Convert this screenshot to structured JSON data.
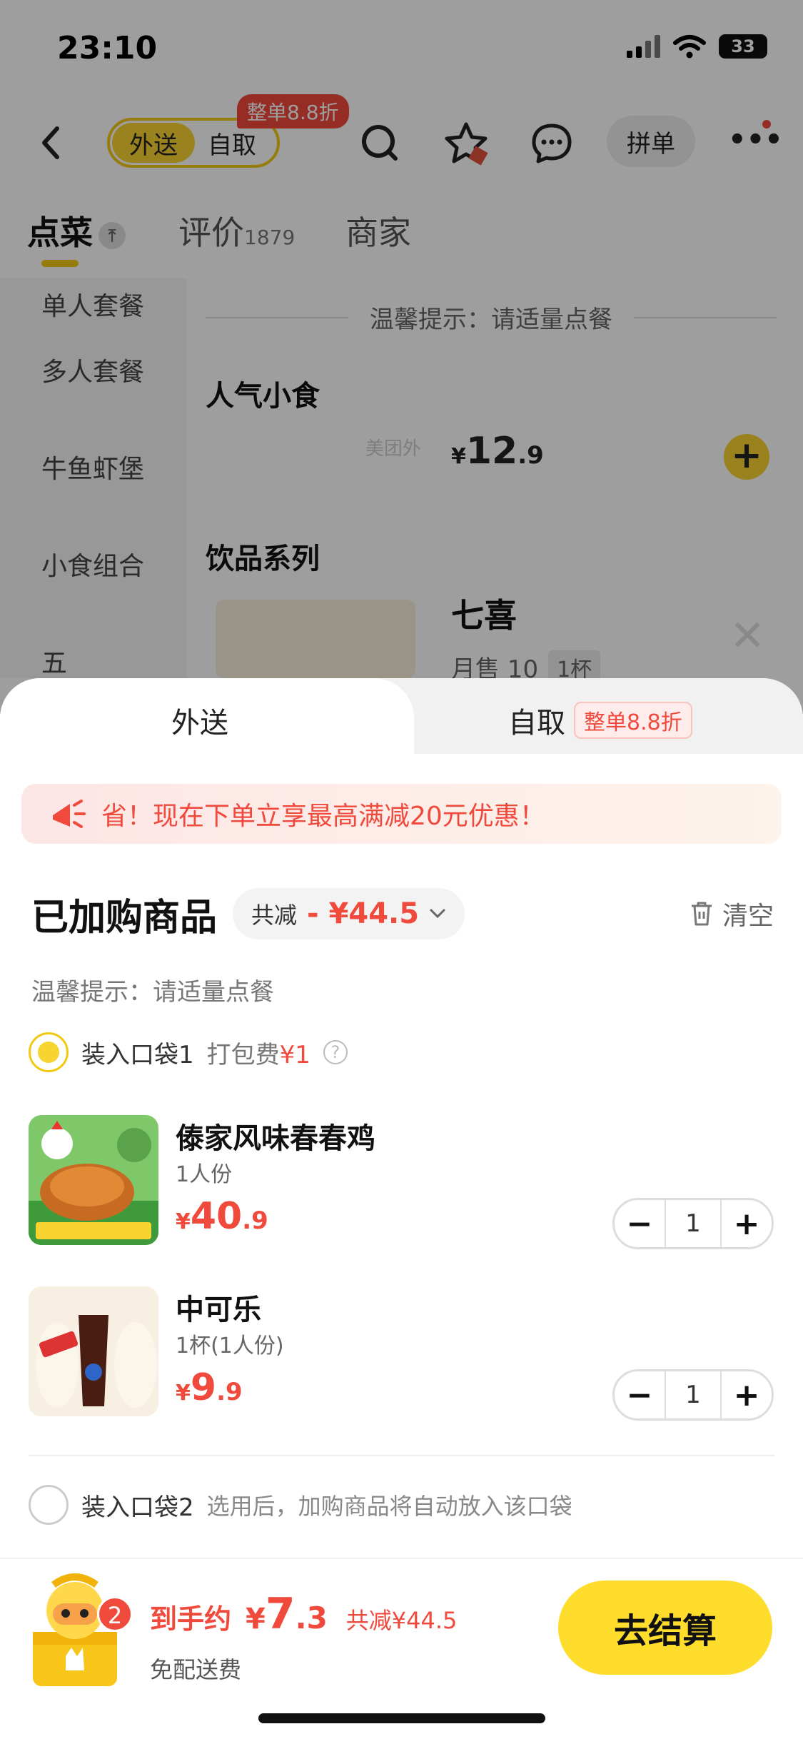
{
  "status_bar": {
    "time": "23:10",
    "battery": "33"
  },
  "nav": {
    "mode_active": "外送",
    "mode_inactive": "自取",
    "discount_tag": "整单8.8折",
    "group_order": "拼单"
  },
  "tabs": [
    {
      "label": "点菜"
    },
    {
      "label": "评价",
      "count": "1879"
    },
    {
      "label": "商家"
    }
  ],
  "sidebar": {
    "categories": [
      "单人套餐",
      "多人套餐",
      "牛鱼虾堡",
      "小食组合",
      "五 "
    ]
  },
  "menu": {
    "tip": "温馨提示：请适量点餐",
    "section_snacks": "人气小食",
    "snack_logo": "美团外",
    "snack_price_currency": "¥",
    "snack_price_int": "12",
    "snack_price_dec": ".9",
    "section_drinks": "饮品系列",
    "drink_name": "七喜",
    "drink_sold": "月售 10",
    "drink_spec": "1杯"
  },
  "sheet": {
    "tab_delivery": "外送",
    "tab_pickup": "自取",
    "tab_pickup_tag": "整单8.8折",
    "promo_text": "省！现在下单立享最高满减20元优惠！",
    "cart_title": "已加购商品",
    "total_label": "共减",
    "total_value": "- ¥44.5",
    "clear_label": "清空",
    "tip": "温馨提示：请适量点餐",
    "bag1_label": "装入口袋1",
    "bag1_fee_label": "打包费",
    "bag1_fee_value": "¥1",
    "items": [
      {
        "name": "傣家风味春春鸡",
        "spec": "1人份",
        "currency": "¥",
        "price_int": "40",
        "price_dec": ".9",
        "qty": "1"
      },
      {
        "name": "中可乐",
        "spec": "1杯(1人份)",
        "currency": "¥",
        "price_int": "9",
        "price_dec": ".9",
        "qty": "1"
      }
    ],
    "bag2_label": "装入口袋2",
    "bag2_hint": "选用后，加购商品将自动放入该口袋"
  },
  "bottom": {
    "cart_count": "2",
    "pay_label": "到手约",
    "pay_currency": "¥",
    "pay_int": "7",
    "pay_dec": ".3",
    "save_text": "共减¥44.5",
    "delivery_text": "免配送费",
    "checkout_label": "去结算"
  },
  "colors": {
    "accent": "#f8d431",
    "price_red": "#f04a3d"
  }
}
